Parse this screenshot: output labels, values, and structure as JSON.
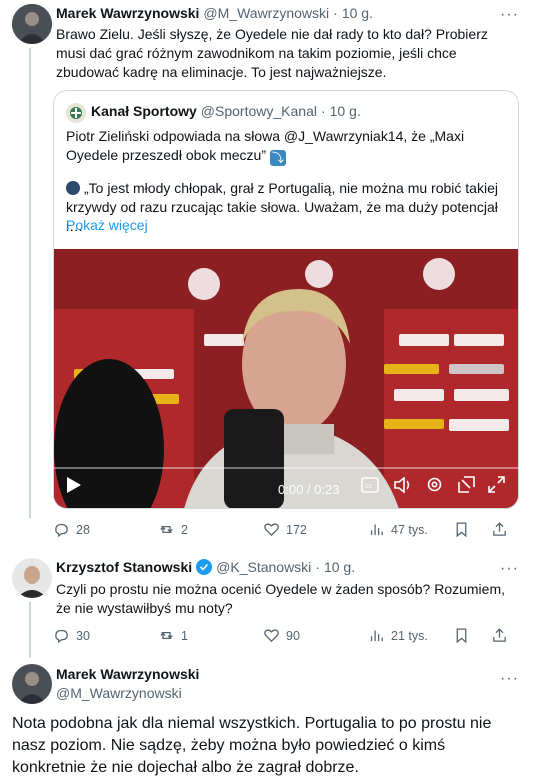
{
  "tweet1": {
    "name": "Marek Wawrzynowski",
    "handle": "@M_Wawrzynowski",
    "dot": "·",
    "time": "10 g.",
    "text": "Brawo Zielu. Jeśli słyszę, że Oyedele nie dał rady to kto dał? Probierz musi dać grać różnym zawodnikom na takim poziomie, jeśli chce zbudować kadrę na eliminacje. To jest najważniejsze.",
    "quote": {
      "name": "Kanał Sportowy",
      "handle": "@Sportowy_Kanal",
      "time": "10 g.",
      "line1": "Piotr Zieliński odpowiada na słowa @J_Wawrzyniak14, że „Maxi Oyedele przeszedł obok meczu”",
      "arrow": "⤵",
      "line2": "„To jest młody chłopak, grał z Portugalią, nie można mu robić takiej krzywdy od razu rzucając takie słowa. Uważam, że ma duży potencjał i…",
      "show_more": "Pokaż więcej",
      "time_display": "0:00 / 0:23"
    },
    "replies": "28",
    "reposts": "2",
    "likes": "172",
    "views": "47 tys."
  },
  "tweet2": {
    "name": "Krzysztof Stanowski",
    "handle": "@K_Stanowski",
    "dot": "·",
    "time": "10 g.",
    "text": "Czyli po prostu nie można ocenić Oyedele w żaden sposób? Rozumiem, że nie wystawiłbyś mu noty?",
    "replies": "30",
    "reposts": "1",
    "likes": "90",
    "views": "21 tys."
  },
  "tweet3": {
    "name": "Marek Wawrzynowski",
    "handle": "@M_Wawrzynowski",
    "text": "Nota podobna jak dla niemal wszystkich. Portugalia to po prostu nie nasz poziom. Nie sądzę, żeby można było powiedzieć o kimś konkretnie że nie dojechał albo że zagrał dobrze."
  },
  "more_label": "···",
  "colors": {
    "accent": "#1d9bf0",
    "muted": "#536471",
    "border": "#cfd9de"
  }
}
